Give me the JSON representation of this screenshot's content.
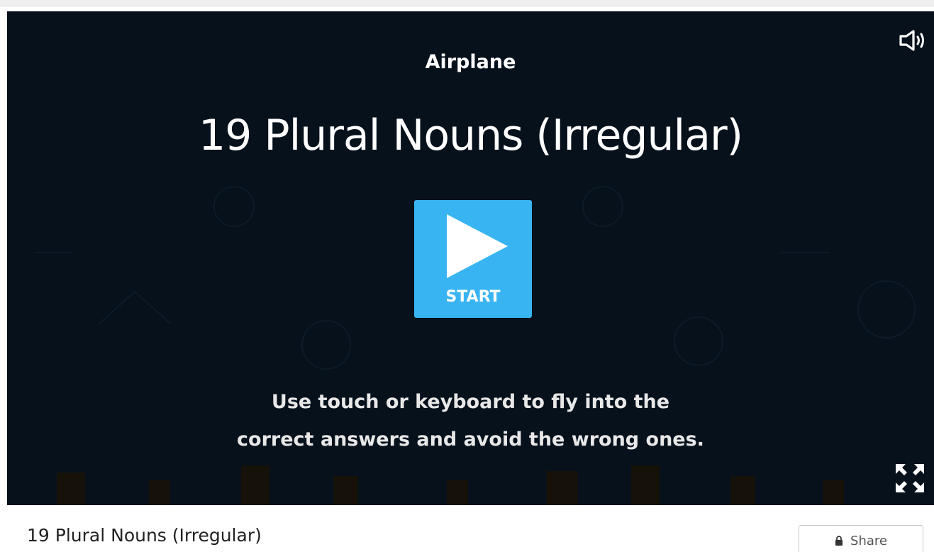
{
  "game": {
    "template_name": "Airplane",
    "activity_title": "19 Plural Nouns (Irregular)",
    "start_label": "START",
    "instructions": [
      "Use touch or keyboard to fly into the",
      "correct answers and avoid the wrong ones."
    ],
    "background_color": "#07111c",
    "start_color": "#38b4f2",
    "icons": {
      "sound": "speaker-icon",
      "fullscreen": "fullscreen-icon",
      "play": "play-icon"
    }
  },
  "footer": {
    "title": "19 Plural Nouns (Irregular)",
    "share_label": "Share",
    "share_icon": "lock-icon"
  }
}
